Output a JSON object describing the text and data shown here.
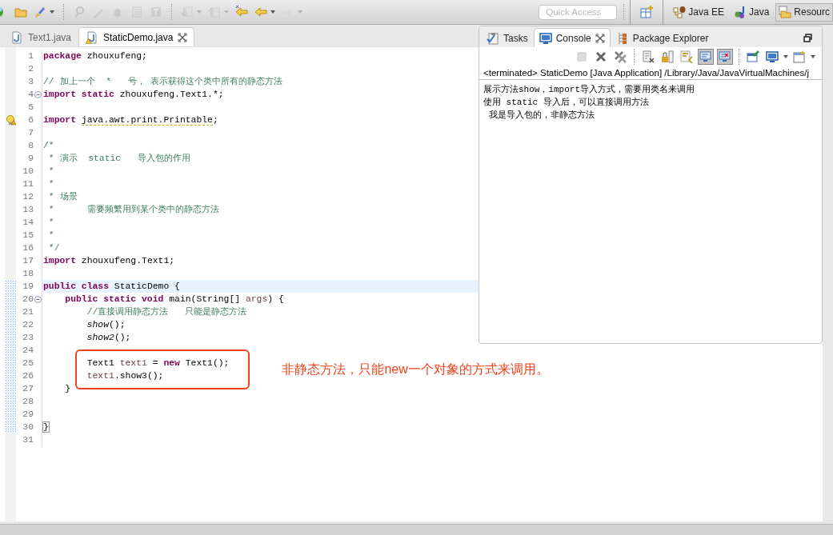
{
  "toolbar": {
    "items": [
      {
        "kind": "new",
        "disabled": false,
        "dropdown": false
      },
      {
        "kind": "open",
        "disabled": false,
        "dropdown": false
      },
      {
        "kind": "brush",
        "disabled": false,
        "dropdown": true
      },
      {
        "kind": "separator"
      },
      {
        "kind": "search-ref",
        "disabled": true,
        "dropdown": false
      },
      {
        "kind": "pen",
        "disabled": true,
        "dropdown": false
      },
      {
        "kind": "bug",
        "disabled": true,
        "dropdown": false
      },
      {
        "kind": "doc",
        "disabled": true,
        "dropdown": false
      },
      {
        "kind": "filter",
        "disabled": true,
        "dropdown": false
      },
      {
        "kind": "separator"
      },
      {
        "kind": "next-annotation",
        "disabled": true,
        "dropdown": true
      },
      {
        "kind": "prev-annotation",
        "disabled": true,
        "dropdown": true
      },
      {
        "kind": "last-edit",
        "disabled": false,
        "dropdown": false
      },
      {
        "kind": "back",
        "disabled": false,
        "dropdown": true
      },
      {
        "kind": "forward",
        "disabled": true,
        "dropdown": true
      }
    ],
    "quick_access": {
      "placeholder": "Quick Access"
    },
    "perspectives": [
      {
        "kind": "open",
        "selected": false
      },
      {
        "kind": "javaee",
        "label": "Java EE",
        "selected": false
      },
      {
        "kind": "java",
        "label": "Java",
        "selected": false
      },
      {
        "kind": "resource",
        "label": "Resourc",
        "selected": true
      }
    ]
  },
  "editor": {
    "tabs": [
      {
        "label": "Text1.java",
        "selected": false,
        "warning": false
      },
      {
        "label": "StaticDemo.java",
        "selected": true,
        "warning": true
      }
    ],
    "lines": [
      {
        "number": "1",
        "current": false,
        "fold": false,
        "warning": false,
        "changed": false,
        "boxed": false,
        "segments": [
          {
            "text": "package",
            "kind": "keyword"
          },
          {
            "text": " zhouxufeng;",
            "kind": "plain"
          }
        ]
      },
      {
        "number": "2",
        "current": false,
        "fold": false,
        "warning": false,
        "changed": false,
        "boxed": false
      },
      {
        "number": "3",
        "current": false,
        "fold": false,
        "warning": false,
        "changed": false,
        "boxed": false,
        "segments": [
          {
            "text": "// 加上一个  *   号， 表示获得这个类中所有的静态方法",
            "kind": "comment"
          }
        ]
      },
      {
        "number": "4",
        "current": false,
        "fold": true,
        "warning": false,
        "changed": false,
        "boxed": false,
        "segments": [
          {
            "text": "import static",
            "kind": "keyword"
          },
          {
            "text": " zhouxufeng.Text1.*;",
            "kind": "plain"
          }
        ]
      },
      {
        "number": "5",
        "current": false,
        "fold": false,
        "warning": false,
        "changed": false,
        "boxed": false
      },
      {
        "number": "6",
        "current": false,
        "fold": false,
        "warning": true,
        "changed": false,
        "boxed": false,
        "segments": [
          {
            "text": "import ",
            "kind": "keyword"
          },
          {
            "text": "java.awt.print.Printable",
            "kind": "unused"
          },
          {
            "text": ";",
            "kind": "plain"
          }
        ]
      },
      {
        "number": "7",
        "current": false,
        "fold": false,
        "warning": false,
        "changed": false,
        "boxed": false
      },
      {
        "number": "8",
        "current": false,
        "fold": false,
        "warning": false,
        "changed": false,
        "boxed": false,
        "segments": [
          {
            "text": "/*",
            "kind": "comment"
          }
        ]
      },
      {
        "number": "9",
        "current": false,
        "fold": false,
        "warning": false,
        "changed": false,
        "boxed": false,
        "segments": [
          {
            "text": " * 演示  static   导入包的作用",
            "kind": "comment"
          }
        ]
      },
      {
        "number": "10",
        "current": false,
        "fold": false,
        "warning": false,
        "changed": false,
        "boxed": false,
        "segments": [
          {
            "text": " *",
            "kind": "comment"
          }
        ]
      },
      {
        "number": "11",
        "current": false,
        "fold": false,
        "warning": false,
        "changed": false,
        "boxed": false,
        "segments": [
          {
            "text": " *",
            "kind": "comment"
          }
        ]
      },
      {
        "number": "12",
        "current": false,
        "fold": false,
        "warning": false,
        "changed": false,
        "boxed": false,
        "segments": [
          {
            "text": " * 场景",
            "kind": "comment"
          }
        ]
      },
      {
        "number": "13",
        "current": false,
        "fold": false,
        "warning": false,
        "changed": false,
        "boxed": false,
        "segments": [
          {
            "text": " *      需要频繁用到某个类中的静态方法",
            "kind": "comment"
          }
        ]
      },
      {
        "number": "14",
        "current": false,
        "fold": false,
        "warning": false,
        "changed": false,
        "boxed": false,
        "segments": [
          {
            "text": " *",
            "kind": "comment"
          }
        ]
      },
      {
        "number": "15",
        "current": false,
        "fold": false,
        "warning": false,
        "changed": false,
        "boxed": false,
        "segments": [
          {
            "text": " *",
            "kind": "comment"
          }
        ]
      },
      {
        "number": "16",
        "current": false,
        "fold": false,
        "warning": false,
        "changed": false,
        "boxed": false,
        "segments": [
          {
            "text": " */",
            "kind": "comment"
          }
        ]
      },
      {
        "number": "17",
        "current": false,
        "fold": false,
        "warning": false,
        "changed": false,
        "boxed": false,
        "segments": [
          {
            "text": "import",
            "kind": "keyword"
          },
          {
            "text": " zhouxufeng.Text1;",
            "kind": "plain"
          }
        ]
      },
      {
        "number": "18",
        "current": false,
        "fold": false,
        "warning": false,
        "changed": false,
        "boxed": false
      },
      {
        "number": "19",
        "current": true,
        "fold": false,
        "warning": false,
        "changed": true,
        "boxed": false,
        "segments": [
          {
            "text": "public class",
            "kind": "keyword"
          },
          {
            "text": " StaticDemo {",
            "kind": "plain"
          }
        ]
      },
      {
        "number": "20",
        "current": false,
        "fold": true,
        "warning": false,
        "changed": true,
        "boxed": false,
        "segments": [
          {
            "text": "    public static void",
            "kind": "keyword"
          },
          {
            "text": " main(String[] ",
            "kind": "plain"
          },
          {
            "text": "args",
            "kind": "local"
          },
          {
            "text": ") {",
            "kind": "plain"
          }
        ]
      },
      {
        "number": "21",
        "current": false,
        "fold": false,
        "warning": false,
        "changed": true,
        "boxed": false,
        "segments": [
          {
            "text": "        //直接调用静态方法   只能是静态方法",
            "kind": "comment"
          }
        ]
      },
      {
        "number": "22",
        "current": false,
        "fold": false,
        "warning": false,
        "changed": true,
        "boxed": false,
        "segments": [
          {
            "text": "        show",
            "kind": "static-call"
          },
          {
            "text": "();",
            "kind": "plain"
          }
        ]
      },
      {
        "number": "23",
        "current": false,
        "fold": false,
        "warning": false,
        "changed": true,
        "boxed": false,
        "segments": [
          {
            "text": "        show2",
            "kind": "static-call"
          },
          {
            "text": "();",
            "kind": "plain"
          }
        ]
      },
      {
        "number": "24",
        "current": false,
        "fold": false,
        "warning": false,
        "changed": true,
        "boxed": false
      },
      {
        "number": "25",
        "current": false,
        "fold": false,
        "warning": false,
        "changed": true,
        "boxed": true,
        "segments": [
          {
            "text": "        Text1 ",
            "kind": "plain"
          },
          {
            "text": "text1",
            "kind": "local"
          },
          {
            "text": " = ",
            "kind": "plain"
          },
          {
            "text": "new",
            "kind": "keyword"
          },
          {
            "text": " Text1();",
            "kind": "plain"
          }
        ]
      },
      {
        "number": "26",
        "current": false,
        "fold": false,
        "warning": false,
        "changed": true,
        "boxed": true,
        "segments": [
          {
            "text": "        text1",
            "kind": "local"
          },
          {
            "text": ".show3();",
            "kind": "plain"
          }
        ]
      },
      {
        "number": "27",
        "current": false,
        "fold": false,
        "warning": false,
        "changed": true,
        "boxed": false,
        "segments": [
          {
            "text": "    }",
            "kind": "plain"
          }
        ]
      },
      {
        "number": "28",
        "current": false,
        "fold": false,
        "warning": false,
        "changed": true,
        "boxed": false
      },
      {
        "number": "29",
        "current": false,
        "fold": false,
        "warning": false,
        "changed": true,
        "boxed": false
      },
      {
        "number": "30",
        "current": false,
        "fold": false,
        "warning": false,
        "changed": true,
        "boxed": false,
        "segments": [
          {
            "text": "}",
            "kind": "bracket"
          }
        ]
      },
      {
        "number": "31",
        "current": false,
        "fold": false,
        "warning": false,
        "changed": false,
        "boxed": false
      }
    ],
    "annotation": {
      "note": "非静态方法，只能new一个对象的方式来调用。"
    }
  },
  "console_view": {
    "tabs": [
      {
        "kind": "tasks",
        "label": "Tasks",
        "selected": false
      },
      {
        "kind": "console",
        "label": "Console",
        "selected": true
      },
      {
        "kind": "package-explorer",
        "label": "Package Explorer",
        "selected": false
      }
    ],
    "toolbar": [
      {
        "kind": "stop",
        "pressed": false
      },
      {
        "kind": "remove",
        "pressed": false
      },
      {
        "kind": "remove-all",
        "pressed": false
      },
      {
        "kind": "separator"
      },
      {
        "kind": "clear",
        "pressed": false
      },
      {
        "kind": "scroll-lock",
        "pressed": false
      },
      {
        "kind": "word-wrap",
        "pressed": false
      },
      {
        "kind": "stdout",
        "pressed": true
      },
      {
        "kind": "stderr",
        "pressed": true
      },
      {
        "kind": "separator"
      },
      {
        "kind": "pin",
        "pressed": false
      },
      {
        "kind": "display",
        "pressed": false
      },
      {
        "kind": "new-console",
        "pressed": false
      }
    ],
    "header": "<terminated> StaticDemo [Java Application] /Library/Java/JavaVirtualMachines/j",
    "output": [
      "展示方法show，import导入方式，需要用类名来调用",
      "使用 static 导入后，可以直接调用方法",
      " 我是导入包的，非静态方法"
    ]
  }
}
